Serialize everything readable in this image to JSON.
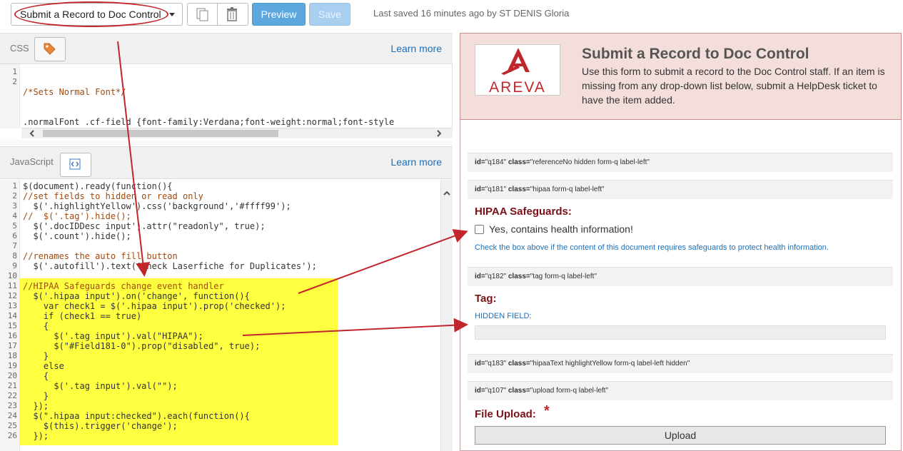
{
  "toolbar": {
    "form_select_value": "Submit a Record to Doc Control",
    "preview_label": "Preview",
    "save_label": "Save",
    "last_saved": "Last saved 16 minutes ago by ST DENIS Gloria"
  },
  "css_pane": {
    "label": "CSS",
    "learn_more": "Learn more",
    "lines": [
      {
        "n": "1",
        "text": "/*Sets Normal Font*/"
      },
      {
        "n": "2",
        "text": ".normalFont .cf-field {font-family:Verdana;font-weight:normal;font-style"
      }
    ]
  },
  "js_pane": {
    "label": "JavaScript",
    "learn_more": "Learn more",
    "lines": [
      {
        "n": "1",
        "text": "$(document).ready(function(){"
      },
      {
        "n": "2",
        "text": "//set fields to hidden or read only"
      },
      {
        "n": "3",
        "text": "  $('.highlightYellow').css('background','#ffff99');"
      },
      {
        "n": "4",
        "text": "//  $('.tag').hide();"
      },
      {
        "n": "5",
        "text": "  $('.docIDDesc input').attr(\"readonly\", true);"
      },
      {
        "n": "6",
        "text": "  $('.count').hide();"
      },
      {
        "n": "7",
        "text": ""
      },
      {
        "n": "8",
        "text": "//renames the auto fill button"
      },
      {
        "n": "9",
        "text": "  $('.autofill').text('Check Laserfiche for Duplicates');"
      },
      {
        "n": "10",
        "text": ""
      },
      {
        "n": "11",
        "text": "//HIPAA Safeguards change event handler"
      },
      {
        "n": "12",
        "text": "  $('.hipaa input').on('change', function(){"
      },
      {
        "n": "13",
        "text": "    var check1 = $('.hipaa input').prop('checked');"
      },
      {
        "n": "14",
        "text": "    if (check1 == true)"
      },
      {
        "n": "15",
        "text": "    {"
      },
      {
        "n": "16",
        "text": "      $('.tag input').val(\"HIPAA\");"
      },
      {
        "n": "17",
        "text": "      $(\"#Field181-0\").prop(\"disabled\", true);"
      },
      {
        "n": "18",
        "text": "    }"
      },
      {
        "n": "19",
        "text": "    else"
      },
      {
        "n": "20",
        "text": "    {"
      },
      {
        "n": "21",
        "text": "      $('.tag input').val(\"\");"
      },
      {
        "n": "22",
        "text": "    }"
      },
      {
        "n": "23",
        "text": "  });"
      },
      {
        "n": "24",
        "text": "  $(\".hipaa input:checked\").each(function(){"
      },
      {
        "n": "25",
        "text": "    $(this).trigger('change');"
      },
      {
        "n": "26",
        "text": "  });"
      }
    ]
  },
  "preview": {
    "logo_text": "AREVA",
    "title": "Submit a Record to Doc Control",
    "description": "Use this form to submit a record to the Doc Control staff. If an item is missing from any drop-down list below, submit a HelpDesk ticket to have the item added.",
    "id_bars": [
      {
        "id": "\"q184\"",
        "class": "\"referenceNo hidden form-q label-left\""
      },
      {
        "id": "\"q181\"",
        "class": "\"hipaa form-q label-left\""
      },
      {
        "id": "\"q182\"",
        "class": "\"tag form-q label-left\""
      },
      {
        "id": "\"q183\"",
        "class": "\"hipaaText highlightYellow form-q label-left hidden\""
      },
      {
        "id": "\"q107\"",
        "class": "\"upload form-q label-left\""
      }
    ],
    "id_prefix": "id=",
    "class_prefix": "class=",
    "hipaa_label": "HIPAA Safeguards:",
    "hipaa_option": "Yes, contains health information!",
    "hipaa_help": "Check the box above if the content of this document requires safeguards to protect health information.",
    "tag_label": "Tag:",
    "hidden_field_label": "HIDDEN FIELD:",
    "upload_label": "File Upload:",
    "required_star": "*",
    "upload_button": "Upload"
  },
  "colors": {
    "annotation_red": "#c0262b",
    "highlight_yellow": "#ffff42",
    "header_pink": "#f3dedc",
    "link_blue": "#1f6fb5",
    "label_maroon": "#7b1117"
  }
}
